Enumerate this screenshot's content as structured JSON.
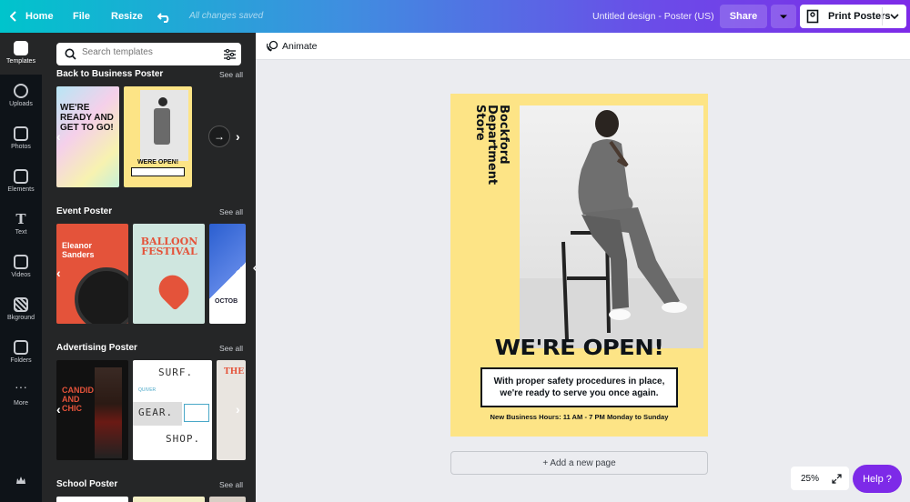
{
  "topbar": {
    "home_label": "Home",
    "file_label": "File",
    "resize_label": "Resize",
    "saved_status": "All changes saved",
    "design_title": "Untitled design - Poster (US)",
    "share_label": "Share",
    "print_label": "Print Posters"
  },
  "rail": {
    "items": [
      {
        "label": "Templates",
        "icon": "templates-icon"
      },
      {
        "label": "Uploads",
        "icon": "uploads-icon"
      },
      {
        "label": "Photos",
        "icon": "photos-icon"
      },
      {
        "label": "Elements",
        "icon": "elements-icon"
      },
      {
        "label": "Text",
        "icon": "text-icon"
      },
      {
        "label": "Videos",
        "icon": "videos-icon"
      },
      {
        "label": "Bkground",
        "icon": "background-icon"
      },
      {
        "label": "Folders",
        "icon": "folders-icon"
      },
      {
        "label": "More",
        "icon": "more-icon"
      }
    ]
  },
  "panel": {
    "search_placeholder": "Search templates",
    "see_all": "See all",
    "sections": [
      {
        "title": "Back to Business Poster"
      },
      {
        "title": "Event Poster"
      },
      {
        "title": "Advertising Poster"
      },
      {
        "title": "School Poster"
      }
    ],
    "thumbs": {
      "bb1": "WE'RE READY AND GET TO GO!",
      "bb2": "WERE OPEN!",
      "ev1": "Eleanor Sanders",
      "ev2": "BALLOON FESTIVAL",
      "ev3": "OCTOB",
      "ad1": "CANDID AND CHIC",
      "ad2_surf": "SURF.",
      "ad2_quiver": "QUIVER",
      "ad2_gear": "GEAR.",
      "ad2_shop": "SHOP.",
      "ad3": "THE"
    }
  },
  "toolbar": {
    "animate_label": "Animate"
  },
  "poster": {
    "store_name_lines": [
      "Bockford",
      "Department",
      "Store"
    ],
    "headline": "WE'RE OPEN!",
    "message_line1": "With proper safety procedures in place,",
    "message_line2": "we're ready to serve you once again.",
    "hours": "New Business Hours: 11 AM - 7 PM Monday to Sunday",
    "bg_color": "#fde486"
  },
  "canvas": {
    "add_page_label": "+ Add a new page",
    "zoom": "25%",
    "help_label": "Help ?"
  },
  "colors": {
    "accent_purple": "#7d2ae8",
    "accent_teal": "#00c4cc",
    "dark_panel": "#252627"
  }
}
